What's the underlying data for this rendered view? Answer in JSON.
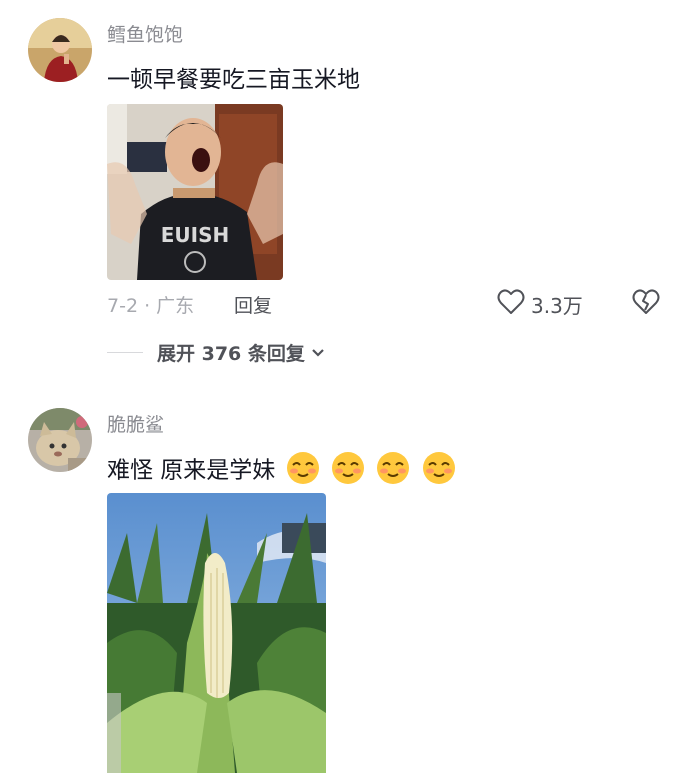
{
  "comments": [
    {
      "username": "鳕鱼饱饱",
      "text": "一顿早餐要吃三亩玉米地",
      "meta": "7-2 · 广东",
      "reply_label": "回复",
      "like_count": "3.3万",
      "expand_label": "展开 376 条回复"
    },
    {
      "username": "脆脆鲨",
      "text": "难怪 原来是学妹",
      "emoji_icon": "pleased-face-emoji"
    }
  ]
}
